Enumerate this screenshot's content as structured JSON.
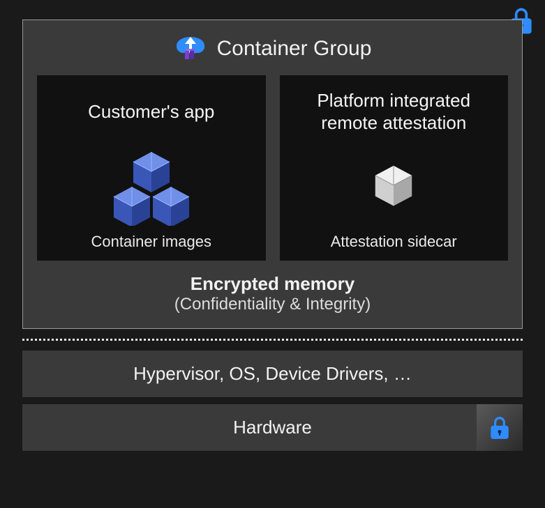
{
  "containerGroup": {
    "title": "Container Group",
    "cards": [
      {
        "title": "Customer's app",
        "footer": "Container images"
      },
      {
        "title": "Platform integrated remote attestation",
        "footer": "Attestation sidecar"
      }
    ],
    "memory": {
      "title": "Encrypted memory",
      "subtitle": "(Confidentiality & Integrity)"
    }
  },
  "layers": [
    {
      "label": "Hypervisor, OS, Device Drivers, …",
      "lock": false
    },
    {
      "label": "Hardware",
      "lock": true
    }
  ],
  "colors": {
    "accentBlue": "#2f8cff",
    "boxBlue": "#4a6fd4"
  }
}
